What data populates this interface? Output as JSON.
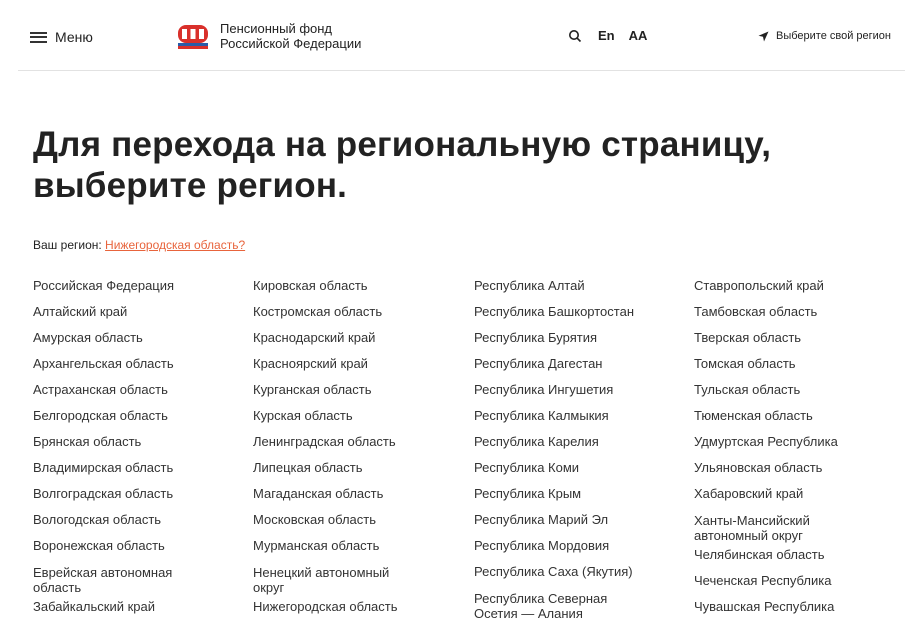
{
  "header": {
    "menu_label": "Меню",
    "logo_line1": "Пенсионный фонд",
    "logo_line2": "Российской Федерации",
    "lang_label": "En",
    "accessibility_label": "AA",
    "region_selector_label": "Выберите свой регион"
  },
  "page_title_line1": "Для перехода на региональную страницу,",
  "page_title_line2": "выберите регион.",
  "your_region": {
    "label": "Ваш регион:",
    "value": "Нижегородская область?"
  },
  "regions": {
    "col1": [
      "Российская Федерация",
      "Алтайский край",
      "Амурская область",
      "Архангельская область",
      "Астраханская область",
      "Белгородская область",
      "Брянская область",
      "Владимирская область",
      "Волгоградская область",
      "Вологодская область",
      "Воронежская область",
      "Еврейская автономная область",
      "Забайкальский край"
    ],
    "col2": [
      "Кировская область",
      "Костромская область",
      "Краснодарский край",
      "Красноярский край",
      "Курганская область",
      "Курская область",
      "Ленинградская область",
      "Липецкая область",
      "Магаданская область",
      "Московская область",
      "Мурманская область",
      "Ненецкий автономный округ",
      "Нижегородская область"
    ],
    "col3": [
      "Республика Алтай",
      "Республика Башкортостан",
      "Республика Бурятия",
      "Республика Дагестан",
      "Республика Ингушетия",
      "Республика Калмыкия",
      "Республика Карелия",
      "Республика Коми",
      "Республика Крым",
      "Республика Марий Эл",
      "Республика Мордовия",
      "Республика Саха (Якутия)",
      "Республика Северная Осетия — Алания"
    ],
    "col4": [
      "Ставропольский край",
      "Тамбовская область",
      "Тверская область",
      "Томская область",
      "Тульская область",
      "Тюменская область",
      "Удмуртская Республика",
      "Ульяновская область",
      "Хабаровский край",
      "Ханты-Мансийский автономный округ",
      "Челябинская область",
      "Чеченская Республика",
      "Чувашская Республика"
    ]
  },
  "colors": {
    "link_accent": "#e8643c",
    "text": "#333333",
    "logo_red": "#d9302b",
    "logo_blue": "#2a5ba8"
  }
}
